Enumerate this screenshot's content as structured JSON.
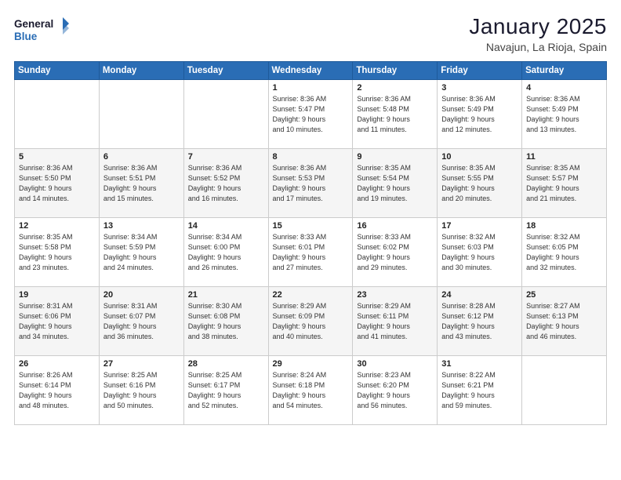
{
  "header": {
    "logo_line1": "General",
    "logo_line2": "Blue",
    "month": "January 2025",
    "location": "Navajun, La Rioja, Spain"
  },
  "weekdays": [
    "Sunday",
    "Monday",
    "Tuesday",
    "Wednesday",
    "Thursday",
    "Friday",
    "Saturday"
  ],
  "weeks": [
    [
      {
        "day": "",
        "info": ""
      },
      {
        "day": "",
        "info": ""
      },
      {
        "day": "",
        "info": ""
      },
      {
        "day": "1",
        "info": "Sunrise: 8:36 AM\nSunset: 5:47 PM\nDaylight: 9 hours\nand 10 minutes."
      },
      {
        "day": "2",
        "info": "Sunrise: 8:36 AM\nSunset: 5:48 PM\nDaylight: 9 hours\nand 11 minutes."
      },
      {
        "day": "3",
        "info": "Sunrise: 8:36 AM\nSunset: 5:49 PM\nDaylight: 9 hours\nand 12 minutes."
      },
      {
        "day": "4",
        "info": "Sunrise: 8:36 AM\nSunset: 5:49 PM\nDaylight: 9 hours\nand 13 minutes."
      }
    ],
    [
      {
        "day": "5",
        "info": "Sunrise: 8:36 AM\nSunset: 5:50 PM\nDaylight: 9 hours\nand 14 minutes."
      },
      {
        "day": "6",
        "info": "Sunrise: 8:36 AM\nSunset: 5:51 PM\nDaylight: 9 hours\nand 15 minutes."
      },
      {
        "day": "7",
        "info": "Sunrise: 8:36 AM\nSunset: 5:52 PM\nDaylight: 9 hours\nand 16 minutes."
      },
      {
        "day": "8",
        "info": "Sunrise: 8:36 AM\nSunset: 5:53 PM\nDaylight: 9 hours\nand 17 minutes."
      },
      {
        "day": "9",
        "info": "Sunrise: 8:35 AM\nSunset: 5:54 PM\nDaylight: 9 hours\nand 19 minutes."
      },
      {
        "day": "10",
        "info": "Sunrise: 8:35 AM\nSunset: 5:55 PM\nDaylight: 9 hours\nand 20 minutes."
      },
      {
        "day": "11",
        "info": "Sunrise: 8:35 AM\nSunset: 5:57 PM\nDaylight: 9 hours\nand 21 minutes."
      }
    ],
    [
      {
        "day": "12",
        "info": "Sunrise: 8:35 AM\nSunset: 5:58 PM\nDaylight: 9 hours\nand 23 minutes."
      },
      {
        "day": "13",
        "info": "Sunrise: 8:34 AM\nSunset: 5:59 PM\nDaylight: 9 hours\nand 24 minutes."
      },
      {
        "day": "14",
        "info": "Sunrise: 8:34 AM\nSunset: 6:00 PM\nDaylight: 9 hours\nand 26 minutes."
      },
      {
        "day": "15",
        "info": "Sunrise: 8:33 AM\nSunset: 6:01 PM\nDaylight: 9 hours\nand 27 minutes."
      },
      {
        "day": "16",
        "info": "Sunrise: 8:33 AM\nSunset: 6:02 PM\nDaylight: 9 hours\nand 29 minutes."
      },
      {
        "day": "17",
        "info": "Sunrise: 8:32 AM\nSunset: 6:03 PM\nDaylight: 9 hours\nand 30 minutes."
      },
      {
        "day": "18",
        "info": "Sunrise: 8:32 AM\nSunset: 6:05 PM\nDaylight: 9 hours\nand 32 minutes."
      }
    ],
    [
      {
        "day": "19",
        "info": "Sunrise: 8:31 AM\nSunset: 6:06 PM\nDaylight: 9 hours\nand 34 minutes."
      },
      {
        "day": "20",
        "info": "Sunrise: 8:31 AM\nSunset: 6:07 PM\nDaylight: 9 hours\nand 36 minutes."
      },
      {
        "day": "21",
        "info": "Sunrise: 8:30 AM\nSunset: 6:08 PM\nDaylight: 9 hours\nand 38 minutes."
      },
      {
        "day": "22",
        "info": "Sunrise: 8:29 AM\nSunset: 6:09 PM\nDaylight: 9 hours\nand 40 minutes."
      },
      {
        "day": "23",
        "info": "Sunrise: 8:29 AM\nSunset: 6:11 PM\nDaylight: 9 hours\nand 41 minutes."
      },
      {
        "day": "24",
        "info": "Sunrise: 8:28 AM\nSunset: 6:12 PM\nDaylight: 9 hours\nand 43 minutes."
      },
      {
        "day": "25",
        "info": "Sunrise: 8:27 AM\nSunset: 6:13 PM\nDaylight: 9 hours\nand 46 minutes."
      }
    ],
    [
      {
        "day": "26",
        "info": "Sunrise: 8:26 AM\nSunset: 6:14 PM\nDaylight: 9 hours\nand 48 minutes."
      },
      {
        "day": "27",
        "info": "Sunrise: 8:25 AM\nSunset: 6:16 PM\nDaylight: 9 hours\nand 50 minutes."
      },
      {
        "day": "28",
        "info": "Sunrise: 8:25 AM\nSunset: 6:17 PM\nDaylight: 9 hours\nand 52 minutes."
      },
      {
        "day": "29",
        "info": "Sunrise: 8:24 AM\nSunset: 6:18 PM\nDaylight: 9 hours\nand 54 minutes."
      },
      {
        "day": "30",
        "info": "Sunrise: 8:23 AM\nSunset: 6:20 PM\nDaylight: 9 hours\nand 56 minutes."
      },
      {
        "day": "31",
        "info": "Sunrise: 8:22 AM\nSunset: 6:21 PM\nDaylight: 9 hours\nand 59 minutes."
      },
      {
        "day": "",
        "info": ""
      }
    ]
  ]
}
